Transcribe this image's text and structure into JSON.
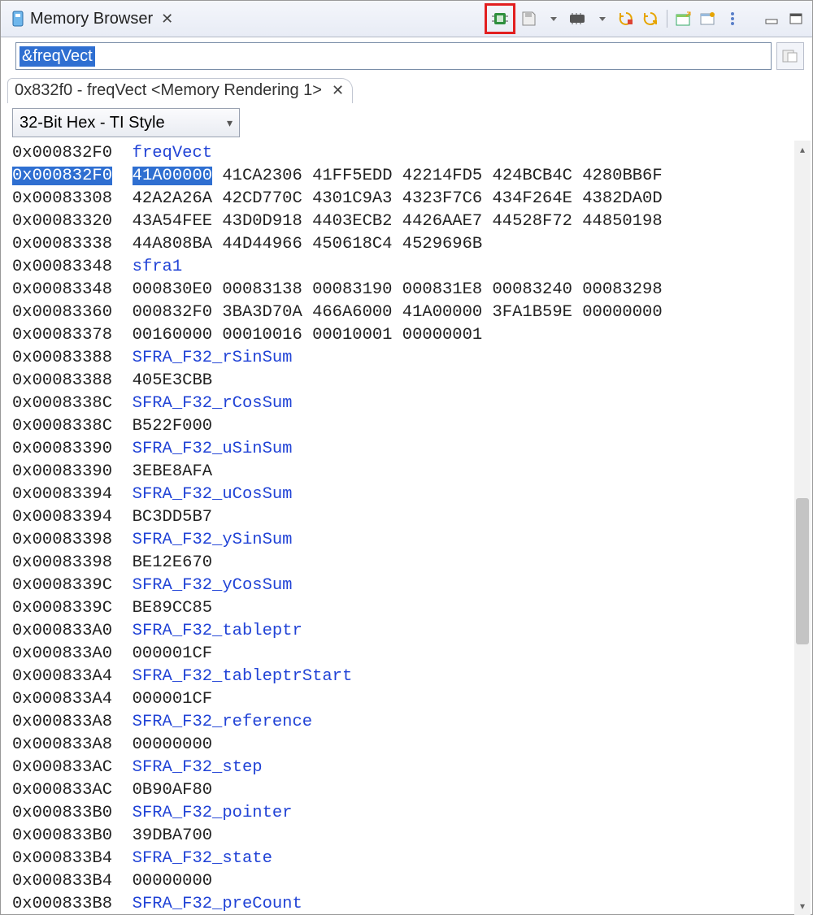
{
  "titlebar": {
    "title": "Memory Browser"
  },
  "address_input": {
    "value": "&freqVect"
  },
  "subtab": {
    "label": "0x832f0 - freqVect <Memory Rendering 1>"
  },
  "format_select": {
    "value": "32-Bit Hex - TI Style"
  },
  "memory": {
    "rows": [
      {
        "addr": "0x000832F0",
        "type": "sym",
        "text": "freqVect"
      },
      {
        "addr": "0x000832F0",
        "type": "hl",
        "first": "41A00000",
        "rest": "41CA2306 41FF5EDD 42214FD5 424BCB4C 4280BB6F"
      },
      {
        "addr": "0x00083308",
        "type": "data",
        "text": "42A2A26A 42CD770C 4301C9A3 4323F7C6 434F264E 4382DA0D"
      },
      {
        "addr": "0x00083320",
        "type": "data",
        "text": "43A54FEE 43D0D918 4403ECB2 4426AAE7 44528F72 44850198"
      },
      {
        "addr": "0x00083338",
        "type": "data",
        "text": "44A808BA 44D44966 450618C4 4529696B"
      },
      {
        "addr": "0x00083348",
        "type": "sym",
        "text": "sfra1"
      },
      {
        "addr": "0x00083348",
        "type": "data",
        "text": "000830E0 00083138 00083190 000831E8 00083240 00083298"
      },
      {
        "addr": "0x00083360",
        "type": "data",
        "text": "000832F0 3BA3D70A 466A6000 41A00000 3FA1B59E 00000000"
      },
      {
        "addr": "0x00083378",
        "type": "data",
        "text": "00160000 00010016 00010001 00000001"
      },
      {
        "addr": "0x00083388",
        "type": "sym",
        "text": "SFRA_F32_rSinSum"
      },
      {
        "addr": "0x00083388",
        "type": "data",
        "text": "405E3CBB"
      },
      {
        "addr": "0x0008338C",
        "type": "sym",
        "text": "SFRA_F32_rCosSum"
      },
      {
        "addr": "0x0008338C",
        "type": "data",
        "text": "B522F000"
      },
      {
        "addr": "0x00083390",
        "type": "sym",
        "text": "SFRA_F32_uSinSum"
      },
      {
        "addr": "0x00083390",
        "type": "data",
        "text": "3EBE8AFA"
      },
      {
        "addr": "0x00083394",
        "type": "sym",
        "text": "SFRA_F32_uCosSum"
      },
      {
        "addr": "0x00083394",
        "type": "data",
        "text": "BC3DD5B7"
      },
      {
        "addr": "0x00083398",
        "type": "sym",
        "text": "SFRA_F32_ySinSum"
      },
      {
        "addr": "0x00083398",
        "type": "data",
        "text": "BE12E670"
      },
      {
        "addr": "0x0008339C",
        "type": "sym",
        "text": "SFRA_F32_yCosSum"
      },
      {
        "addr": "0x0008339C",
        "type": "data",
        "text": "BE89CC85"
      },
      {
        "addr": "0x000833A0",
        "type": "sym",
        "text": "SFRA_F32_tableptr"
      },
      {
        "addr": "0x000833A0",
        "type": "data",
        "text": "000001CF"
      },
      {
        "addr": "0x000833A4",
        "type": "sym",
        "text": "SFRA_F32_tableptrStart"
      },
      {
        "addr": "0x000833A4",
        "type": "data",
        "text": "000001CF"
      },
      {
        "addr": "0x000833A8",
        "type": "sym",
        "text": "SFRA_F32_reference"
      },
      {
        "addr": "0x000833A8",
        "type": "data",
        "text": "00000000"
      },
      {
        "addr": "0x000833AC",
        "type": "sym",
        "text": "SFRA_F32_step"
      },
      {
        "addr": "0x000833AC",
        "type": "data",
        "text": "0B90AF80"
      },
      {
        "addr": "0x000833B0",
        "type": "sym",
        "text": "SFRA_F32_pointer"
      },
      {
        "addr": "0x000833B0",
        "type": "data",
        "text": "39DBA700"
      },
      {
        "addr": "0x000833B4",
        "type": "sym",
        "text": "SFRA_F32_state"
      },
      {
        "addr": "0x000833B4",
        "type": "data",
        "text": "00000000"
      },
      {
        "addr": "0x000833B8",
        "type": "sym",
        "text": "SFRA_F32_preCount"
      }
    ]
  },
  "icons": {
    "memory": "memory-icon",
    "chip": "chip-icon",
    "save": "save-icon",
    "chip2": "chip2-icon",
    "refresh_stop": "refresh-stop-icon",
    "refresh": "refresh-icon",
    "new_tab": "new-tab-icon",
    "pin": "pin-icon",
    "more": "more-icon",
    "minimize": "minimize-icon",
    "maximize": "maximize-icon",
    "go": "go-icon"
  }
}
